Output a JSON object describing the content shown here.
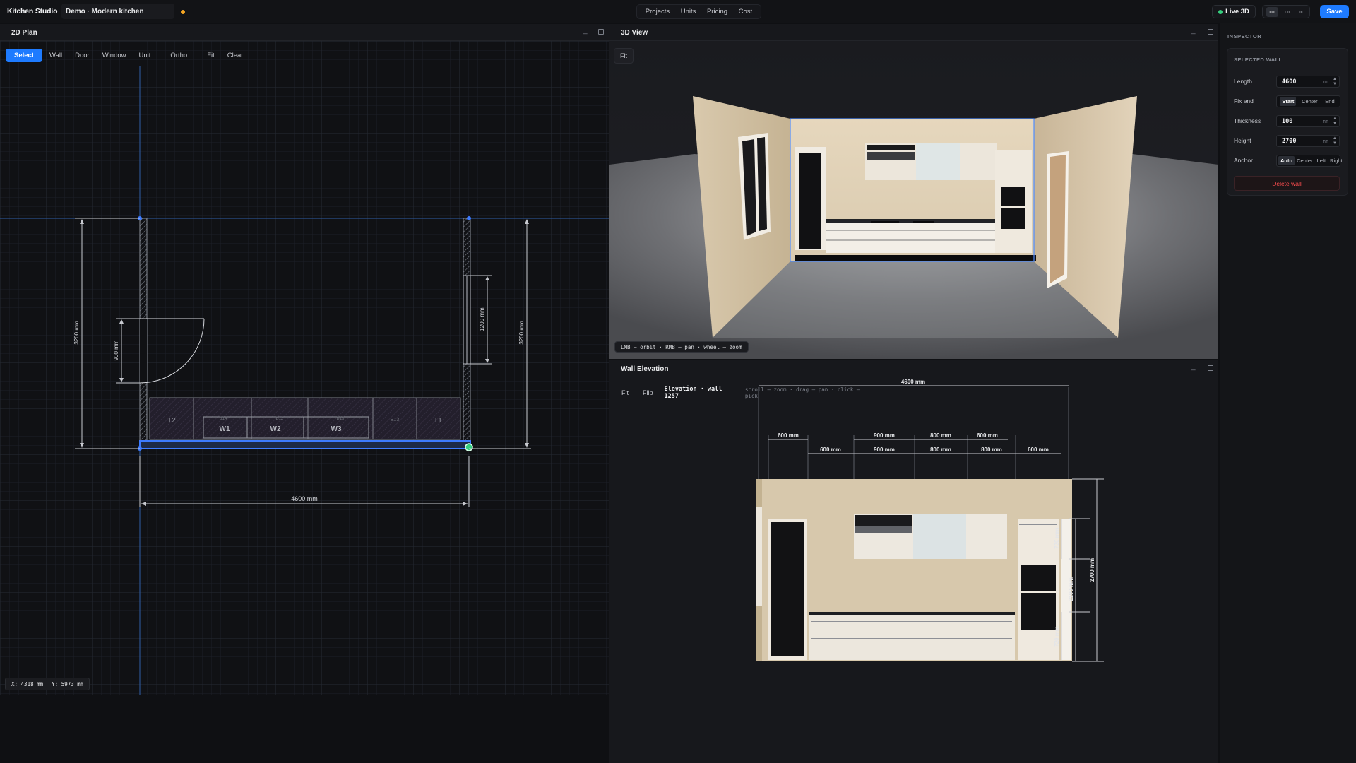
{
  "app": {
    "title": "Kitchen Studio",
    "project": "Demo · Modern kitchen"
  },
  "topnav": {
    "items": [
      "Projects",
      "Units",
      "Pricing",
      "Cost"
    ]
  },
  "topright": {
    "live3d": "Live 3D",
    "units": [
      "mm",
      "cm",
      "m"
    ],
    "active_unit": "mm",
    "save": "Save"
  },
  "plan": {
    "title": "2D Plan",
    "tools": [
      "Select",
      "Wall",
      "Door",
      "Window",
      "Unit",
      "Ortho",
      "Fit",
      "Clear"
    ],
    "active_tool": "Select",
    "dims": {
      "width": "4600 mm",
      "left_depth": "3200 mm",
      "right_depth": "3200 mm",
      "door": "900 mm",
      "window": "1200 mm"
    },
    "units": [
      "T2",
      "W1",
      "W2",
      "W3",
      "T1"
    ],
    "unit_small": [
      "B14",
      "B12",
      "B15",
      "B13"
    ],
    "coords": {
      "x": "X: 4318 mm",
      "y": "Y: 5973 mm"
    }
  },
  "view3d": {
    "title": "3D View",
    "fit": "Fit",
    "hint": "LMB — orbit · RMB — pan · wheel — zoom"
  },
  "elevation": {
    "title": "Wall Elevation",
    "fit": "Fit",
    "flip": "Flip",
    "label": "Elevation · wall 1257",
    "hint": "scroll — zoom · drag — pan · click — pick",
    "total": "4600 mm",
    "top_dims": [
      "600 mm",
      "900 mm",
      "800 mm",
      "600 mm"
    ],
    "mid_dims": [
      "600 mm",
      "900 mm",
      "800 mm",
      "800 mm",
      "600 mm"
    ],
    "right_dims": [
      "720 mm",
      "2100 mm",
      "720 mm",
      "2700 mm"
    ]
  },
  "inspector": {
    "title": "INSPECTOR",
    "section": "SELECTED WALL",
    "length_label": "Length",
    "length": "4600",
    "unit": "mm",
    "fixend_label": "Fix end",
    "fixend_options": [
      "Start",
      "Center",
      "End"
    ],
    "fixend_active": "Start",
    "thickness_label": "Thickness",
    "thickness": "100",
    "height_label": "Height",
    "height": "2700",
    "anchor_label": "Anchor",
    "anchor_options": [
      "Auto",
      "Center",
      "Left",
      "Right"
    ],
    "anchor_active": "Auto",
    "delete": "Delete wall"
  },
  "colors": {
    "accent": "#1e7bff",
    "wall": "#e4d6bf",
    "floor": "#6b6c70",
    "danger": "#ff4d4f",
    "live": "#35d07f"
  }
}
